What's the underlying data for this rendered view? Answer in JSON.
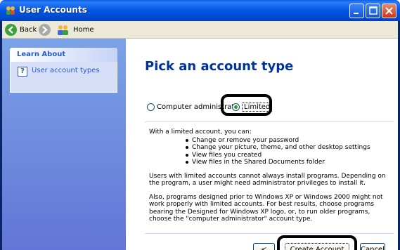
{
  "window": {
    "title": "User Accounts"
  },
  "toolbar": {
    "back_label": "Back",
    "home_label": "Home"
  },
  "sidebar": {
    "panel_title": "Learn About",
    "items": [
      {
        "label": "User account types"
      }
    ]
  },
  "main": {
    "title": "Pick an account type",
    "options": [
      {
        "label": "Computer administrator",
        "shown": "Computer administrato",
        "selected": false
      },
      {
        "label": "Limited",
        "selected": true
      }
    ],
    "description": {
      "intro": "With a limited account, you can:",
      "bullets": [
        "Change or remove your password",
        "Change your picture, theme, and other desktop settings",
        "View files you created",
        "View files in the Shared Documents folder"
      ],
      "para1": "Users with limited accounts cannot always install programs. Depending on the program, a user might need administrator privileges to install it.",
      "para2": "Also, programs designed prior to Windows XP or Windows 2000 might not work properly with limited accounts. For best results, choose programs bearing the Designed for Windows XP logo, or, to run older programs, choose the \"computer administrator\" account type."
    },
    "buttons": {
      "back": "< Back",
      "create": "Create Account",
      "cancel": "Cancel"
    }
  },
  "colors": {
    "title_bar": "#0055e5",
    "sidebar": "#6f8ce0",
    "heading": "#003399",
    "link": "#215dc6",
    "highlight_ring": "#000000"
  },
  "icons": [
    "user-accounts-icon",
    "minimize-icon",
    "maximize-icon",
    "close-icon",
    "back-arrow-icon",
    "forward-arrow-icon",
    "home-users-icon",
    "help-icon"
  ]
}
